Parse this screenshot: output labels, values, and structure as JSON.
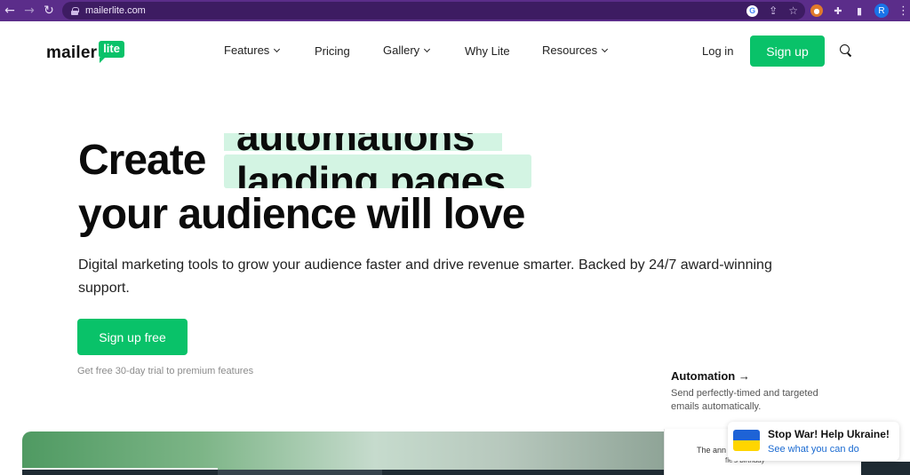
{
  "browser": {
    "url": "mailerlite.com",
    "profile_initial": "R",
    "icons": [
      "back-arrow-icon",
      "forward-arrow-icon",
      "reload-icon",
      "lock-icon",
      "google-icon",
      "share-icon",
      "star-icon",
      "extension-icon",
      "puzzle-icon",
      "sidebar-icon",
      "profile-avatar",
      "menu-kebab-icon"
    ]
  },
  "header": {
    "logo_text": "mailer",
    "logo_badge": "lite",
    "nav": [
      {
        "label": "Features",
        "dropdown": true
      },
      {
        "label": "Pricing",
        "dropdown": false
      },
      {
        "label": "Gallery",
        "dropdown": true
      },
      {
        "label": "Why Lite",
        "dropdown": false
      },
      {
        "label": "Resources",
        "dropdown": true
      }
    ],
    "login": "Log in",
    "signup": "Sign up"
  },
  "hero": {
    "create": "Create",
    "rotating_words": [
      "automations",
      "landing pages"
    ],
    "line2": "your audience will love",
    "subtitle": "Digital marketing tools to grow your audience faster and drive revenue smarter. Backed by 24/7 award-winning support.",
    "cta": "Sign up free",
    "trial_note": "Get free 30-day trial to premium features"
  },
  "feature": {
    "title": "Automation →",
    "description": "Send perfectly-timed and targeted emails automatically."
  },
  "preview_card": {
    "line1": "The ann",
    "line2": "fie's birthday"
  },
  "ukraine_banner": {
    "title": "Stop War! Help Ukraine!",
    "link": "See what you can do"
  },
  "colors": {
    "brand_green": "#09c269",
    "highlight_mint": "#d3f4e3",
    "browser_purple": "#5b2d8a"
  }
}
